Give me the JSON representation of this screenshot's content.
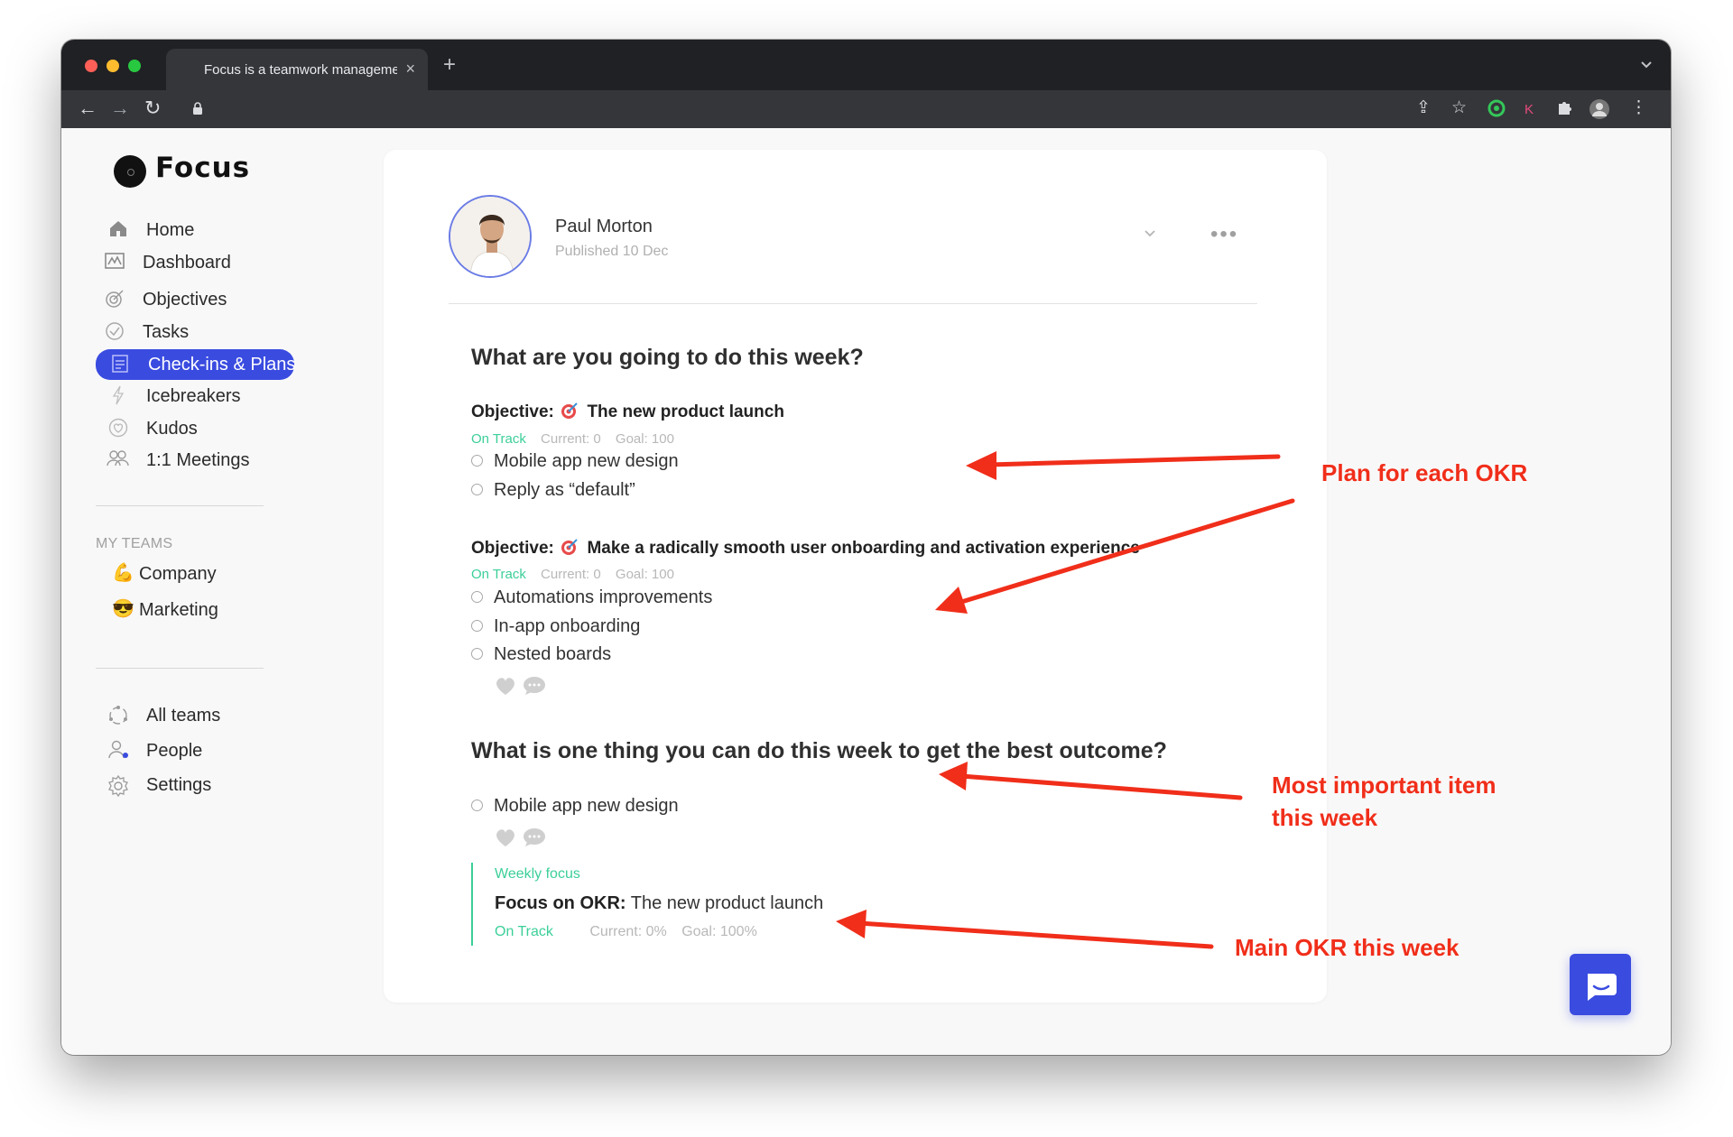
{
  "browser": {
    "tab_title": "Focus is a teamwork management tool",
    "tab_close": "×",
    "new_tab": "+",
    "tab_menu": "⌄",
    "nav_back": "←",
    "nav_forward": "→",
    "nav_reload": "↻",
    "share": "⇪",
    "bookmark": "☆",
    "ext_k": "K",
    "menu": "⋮"
  },
  "app": {
    "logo": "Focus"
  },
  "sidebar": {
    "nav": [
      {
        "label": "Home",
        "icon": "house-icon"
      },
      {
        "label": "Dashboard",
        "icon": "chart-icon"
      },
      {
        "label": "Objectives",
        "icon": "target-icon"
      },
      {
        "label": "Tasks",
        "icon": "check-circle-icon"
      },
      {
        "label": "Check-ins & Plans",
        "icon": "document-icon",
        "active": true
      },
      {
        "label": "Icebreakers",
        "icon": "bolt-icon"
      },
      {
        "label": "Kudos",
        "icon": "heart-icon"
      },
      {
        "label": "1:1 Meetings",
        "icon": "people-icon"
      }
    ],
    "teams_label": "MY TEAMS",
    "teams": [
      {
        "label": "Company",
        "emoji": "💪"
      },
      {
        "label": "Marketing",
        "emoji": "😎"
      }
    ],
    "bottom": [
      {
        "label": "All teams",
        "icon": "cycle-icon"
      },
      {
        "label": "People",
        "icon": "person-icon"
      },
      {
        "label": "Settings",
        "icon": "gear-icon"
      }
    ]
  },
  "post": {
    "author": "Paul Morton",
    "published": "Published 10 Dec",
    "more": "•••",
    "q1": "What are you going to do this week?",
    "objectives": [
      {
        "prefix": "Objective:",
        "title": "The new product launch",
        "status": "On Track",
        "current": "Current: 0",
        "goal": "Goal: 100",
        "items": [
          "Mobile app new design",
          "Reply as “default”"
        ]
      },
      {
        "prefix": "Objective:",
        "title": "Make a radically smooth user onboarding and activation experience",
        "status": "On Track",
        "current": "Current: 0",
        "goal": "Goal: 100",
        "items": [
          "Automations improvements",
          "In-app onboarding",
          "Nested boards"
        ]
      }
    ],
    "q2": "What is one thing you can do this week to get the best outcome?",
    "q2_items": [
      "Mobile app new design"
    ],
    "weekly": {
      "label": "Weekly focus",
      "prefix": "Focus on OKR:",
      "title": "The new product launch",
      "status": "On Track",
      "current": "Current: 0%",
      "goal": "Goal: 100%"
    }
  },
  "annotations": {
    "a1": "Plan for each OKR",
    "a2_line1": "Most important item",
    "a2_line2": "this week",
    "a3": "Main OKR this week",
    "arrow_color": "#f02e1a"
  },
  "colors": {
    "accent": "#3a4be0",
    "on_track": "#3ccf99",
    "annotation": "#f02e1a"
  }
}
